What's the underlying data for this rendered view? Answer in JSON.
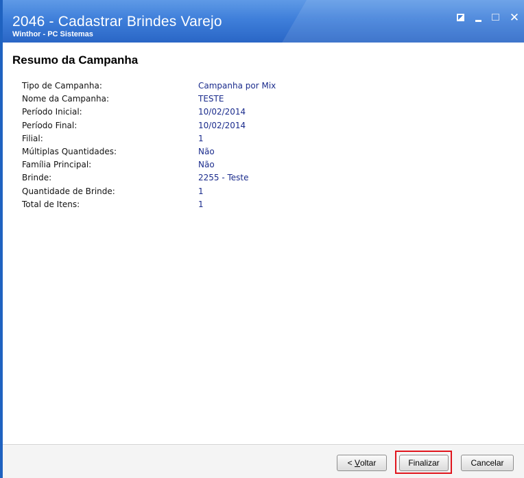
{
  "window": {
    "title": "2046 - Cadastrar Brindes Varejo",
    "subtitle": "Winthor - PC Sistemas",
    "controls": [
      "restore-icon",
      "minimize-icon",
      "maximize-icon",
      "close-icon"
    ],
    "close_glyph": "✕"
  },
  "summary": {
    "heading": "Resumo da Campanha",
    "rows": [
      {
        "label": "Tipo de Campanha:",
        "value": "Campanha por Mix"
      },
      {
        "label": "Nome da Campanha:",
        "value": "TESTE"
      },
      {
        "label": "Período Inicial:",
        "value": "10/02/2014"
      },
      {
        "label": "Período Final:",
        "value": "10/02/2014"
      },
      {
        "label": "Filial:",
        "value": "1"
      },
      {
        "label": "Múltiplas Quantidades:",
        "value": "Não"
      },
      {
        "label": "Família Principal:",
        "value": "Não"
      },
      {
        "label": "Brinde:",
        "value": "2255 - Teste"
      },
      {
        "label": "Quantidade de Brinde:",
        "value": "1"
      },
      {
        "label": "Total de Itens:",
        "value": "1"
      }
    ]
  },
  "buttons": {
    "voltar_prefix": "< ",
    "voltar_mnemonic": "V",
    "voltar_rest": "oltar",
    "finalizar": "Finalizar",
    "cancelar": "Cancelar"
  },
  "colors": {
    "titlebar": "#3f7fda",
    "value_text": "#1a2b8c",
    "highlight": "#e0141c"
  }
}
